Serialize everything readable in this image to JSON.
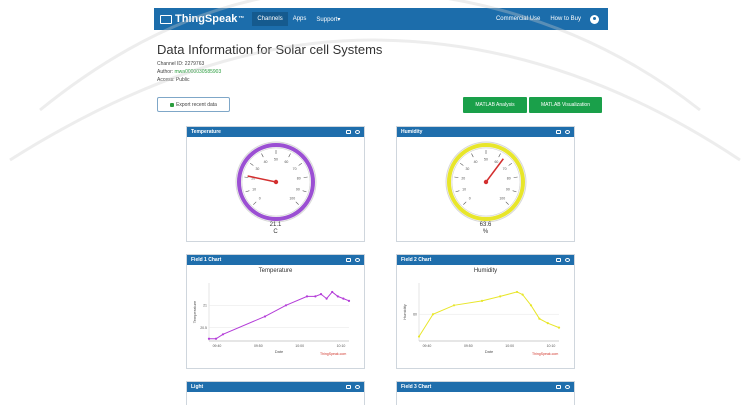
{
  "navbar": {
    "brand": "ThingSpeak",
    "tm": "™",
    "items": [
      {
        "label": "Channels"
      },
      {
        "label": "Apps"
      },
      {
        "label": "Support▾"
      }
    ],
    "right_items": [
      {
        "label": "Commercial Use"
      },
      {
        "label": "How to Buy"
      }
    ]
  },
  "channel": {
    "title": "Data Information for Solar cell Systems",
    "channel_id": "Channel ID: 2279763",
    "author_prefix": "Author: ",
    "author": "mwa0000030585903",
    "access": "Access: Public"
  },
  "buttons": {
    "export": "Export recent data",
    "analysis": "MATLAB Analysis",
    "visualization": "MATLAB Visualization"
  },
  "panels": [
    {
      "title": "Temperature",
      "value": "21.1",
      "unit": "C",
      "gauge": {
        "min": 0,
        "max": 100,
        "value": 21.1,
        "color": "#9b4fd3",
        "ticks": [
          "0",
          "10",
          "20",
          "30",
          "40",
          "50",
          "60",
          "70",
          "80",
          "90",
          "100"
        ]
      }
    },
    {
      "title": "Humidity",
      "value": "63.6",
      "unit": "%",
      "gauge": {
        "min": 0,
        "max": 100,
        "value": 63.6,
        "color": "#e8e62a",
        "ticks": [
          "0",
          "10",
          "20",
          "30",
          "40",
          "50",
          "60",
          "70",
          "80",
          "90",
          "100"
        ]
      }
    },
    {
      "title": "Field 1 Chart"
    },
    {
      "title": "Field 2 Chart"
    },
    {
      "title": "Light"
    },
    {
      "title": "Field 3 Chart"
    }
  ],
  "chart_data": [
    {
      "type": "line",
      "title": "Temperature",
      "xlabel": "Date",
      "ylabel": "Temperature",
      "x_ticks": [
        "09:40",
        "09:50",
        "10:00",
        "10:10"
      ],
      "y_ticks": [
        "20.5",
        "21"
      ],
      "color": "#b33bd8",
      "x": [
        0.0,
        0.05,
        0.1,
        0.4,
        0.55,
        0.7,
        0.76,
        0.8,
        0.84,
        0.88,
        0.92,
        0.96,
        1.0
      ],
      "values": [
        20.25,
        20.25,
        20.35,
        20.75,
        21.0,
        21.2,
        21.2,
        21.25,
        21.15,
        21.3,
        21.2,
        21.15,
        21.1
      ],
      "ylim": [
        20.2,
        21.5
      ],
      "credit": "ThingSpeak.com"
    },
    {
      "type": "line",
      "title": "Humidity",
      "xlabel": "Date",
      "ylabel": "Humidity",
      "x_ticks": [
        "09:40",
        "09:50",
        "10:00",
        "10:10"
      ],
      "y_ticks": [
        "60"
      ],
      "color": "#e8e62a",
      "x": [
        0.0,
        0.1,
        0.25,
        0.45,
        0.58,
        0.7,
        0.74,
        0.8,
        0.86,
        0.92,
        1.0
      ],
      "values": [
        57.5,
        60.0,
        61.0,
        61.5,
        62.0,
        62.5,
        62.2,
        61.0,
        59.5,
        59.0,
        58.5
      ],
      "ylim": [
        57.0,
        63.5
      ],
      "credit": "ThingSpeak.com"
    }
  ]
}
